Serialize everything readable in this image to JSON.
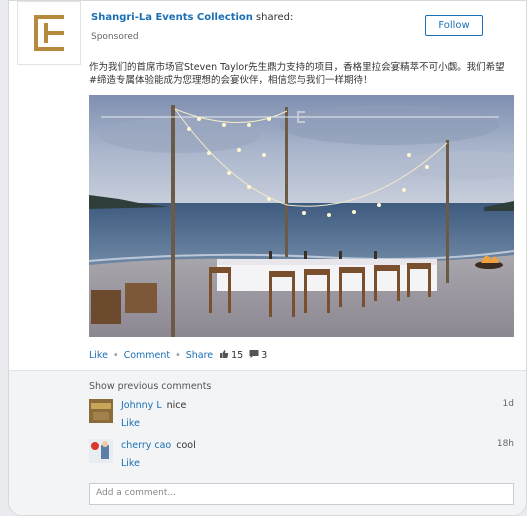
{
  "post": {
    "author": "Shangri-La Events Collection",
    "action": "shared:",
    "sponsored": "Sponsored",
    "follow_label": "Follow",
    "text": "作为我们的首席市场官Steven Taylor先生鼎力支持的项目，香格里拉会宴精萃不可小觑。我们希望#缔造专属体验能成为您理想的会宴伙伴，相信您与我们一样期待！",
    "image_alt": "Beach dinner table with string lights at dusk"
  },
  "actions": {
    "like": "Like",
    "comment": "Comment",
    "share": "Share",
    "like_count": "15",
    "comment_count": "3"
  },
  "comments": {
    "show_previous": "Show previous comments",
    "items": [
      {
        "author": "Johnny L",
        "text": "nice",
        "time": "1d",
        "like": "Like"
      },
      {
        "author": "cherry cao",
        "text": "cool",
        "time": "18h",
        "like": "Like"
      }
    ],
    "add_placeholder": "Add a comment..."
  },
  "colors": {
    "link": "#1a6fb5",
    "brand_gold": "#b58a3f"
  }
}
